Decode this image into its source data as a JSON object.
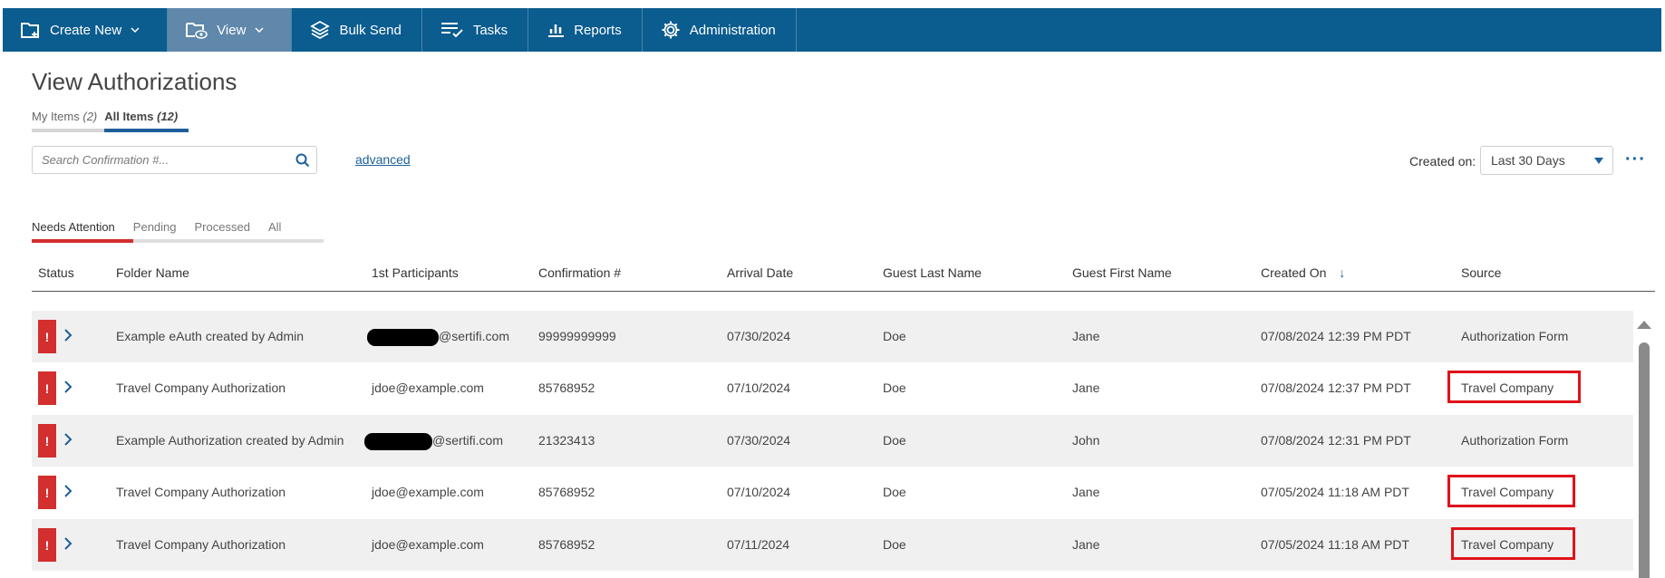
{
  "nav": {
    "create_new": "Create New",
    "view": "View",
    "bulk_send": "Bulk Send",
    "tasks": "Tasks",
    "reports": "Reports",
    "administration": "Administration"
  },
  "page_title": "View Authorizations",
  "view_tabs": {
    "my_items_label": "My Items",
    "my_items_count": "(2)",
    "all_items_label": "All Items",
    "all_items_count": "(12)"
  },
  "search": {
    "placeholder": "Search Confirmation #..."
  },
  "advanced_link": "advanced",
  "created_on": {
    "label": "Created on:",
    "value": "Last 30 Days"
  },
  "more_menu": "···",
  "status_tabs": [
    "Needs Attention",
    "Pending",
    "Processed",
    "All"
  ],
  "columns": [
    "Status",
    "Folder Name",
    "1st Participants",
    "Confirmation #",
    "Arrival Date",
    "Guest Last Name",
    "Guest First Name",
    "Created On",
    "Source"
  ],
  "sort_indicator": "↓",
  "rows": [
    {
      "status": "!",
      "folder": "Example eAuth created by Admin",
      "participant": "@sertifi.com",
      "confirmation": "99999999999",
      "arrival": "07/30/2024",
      "last": "Doe",
      "first": "Jane",
      "created": "07/08/2024 12:39 PM PDT",
      "source": "Authorization Form"
    },
    {
      "status": "!",
      "folder": "Travel Company Authorization",
      "participant": "jdoe@example.com",
      "confirmation": "85768952",
      "arrival": "07/10/2024",
      "last": "Doe",
      "first": "Jane",
      "created": "07/08/2024 12:37 PM PDT",
      "source": "Travel Company"
    },
    {
      "status": "!",
      "folder": "Example Authorization created by Admin",
      "participant": "@sertifi.com",
      "confirmation": "21323413",
      "arrival": "07/30/2024",
      "last": "Doe",
      "first": "John",
      "created": "07/08/2024 12:31 PM PDT",
      "source": "Authorization Form"
    },
    {
      "status": "!",
      "folder": "Travel Company Authorization",
      "participant": "jdoe@example.com",
      "confirmation": "85768952",
      "arrival": "07/10/2024",
      "last": "Doe",
      "first": "Jane",
      "created": "07/05/2024 11:18 AM PDT",
      "source": "Travel Company"
    },
    {
      "status": "!",
      "folder": "Travel Company Authorization",
      "participant": "jdoe@example.com",
      "confirmation": "85768952",
      "arrival": "07/11/2024",
      "last": "Doe",
      "first": "Jane",
      "created": "07/05/2024 11:18 AM PDT",
      "source": "Travel Company"
    }
  ],
  "colors": {
    "nav_bg": "#0b5c8f",
    "nav_active": "#5f88ab",
    "accent_blue": "#1e5f99",
    "attention_red": "#d32f2f",
    "highlight_red": "#e0121b",
    "row_shade": "#f0f0f0"
  }
}
